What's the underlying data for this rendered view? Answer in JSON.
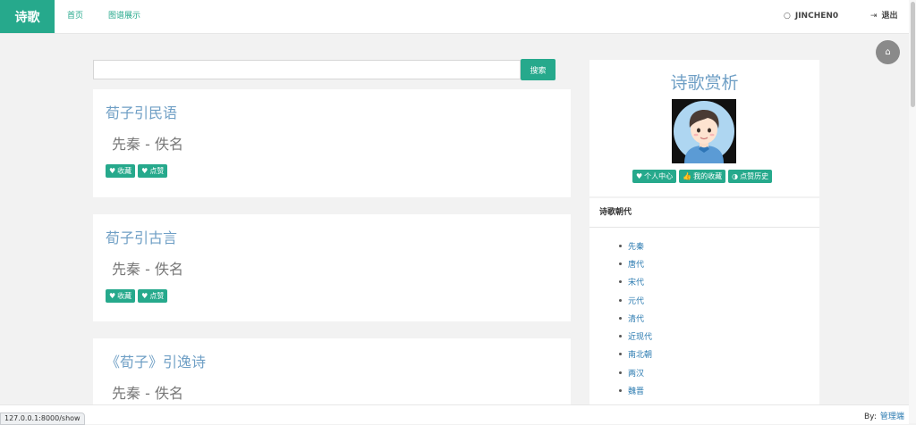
{
  "nav": {
    "brand": "诗歌",
    "links": [
      "首页",
      "图谱展示"
    ],
    "user_icon": "user-circle-icon",
    "username": "JINCHEN0",
    "logout_icon": "sign-out-icon",
    "logout": "退出"
  },
  "search": {
    "value": "",
    "placeholder": "",
    "button": "搜索"
  },
  "poems": [
    {
      "title": "荀子引民语",
      "author": "先秦 - 佚名",
      "collect": "收藏",
      "like": "点赞"
    },
    {
      "title": "荀子引古言",
      "author": "先秦 - 佚名",
      "collect": "收藏",
      "like": "点赞"
    },
    {
      "title": "《荀子》引逸诗",
      "author": "先秦 - 佚名"
    }
  ],
  "sidebar": {
    "title": "诗歌赏析",
    "buttons": [
      "个人中心",
      "我的收藏",
      "点赞历史"
    ],
    "dynasty_header": "诗歌朝代",
    "dynasties": [
      "先秦",
      "唐代",
      "宋代",
      "元代",
      "清代",
      "近现代",
      "南北朝",
      "两汉",
      "魏晋"
    ]
  },
  "footer": {
    "by": "By:",
    "admin": "管理端",
    "status_url": "127.0.0.1:8000/show"
  },
  "colors": {
    "accent": "#26a98c",
    "title_blue": "#6f9fc5",
    "link_blue": "#2a7ab0"
  }
}
